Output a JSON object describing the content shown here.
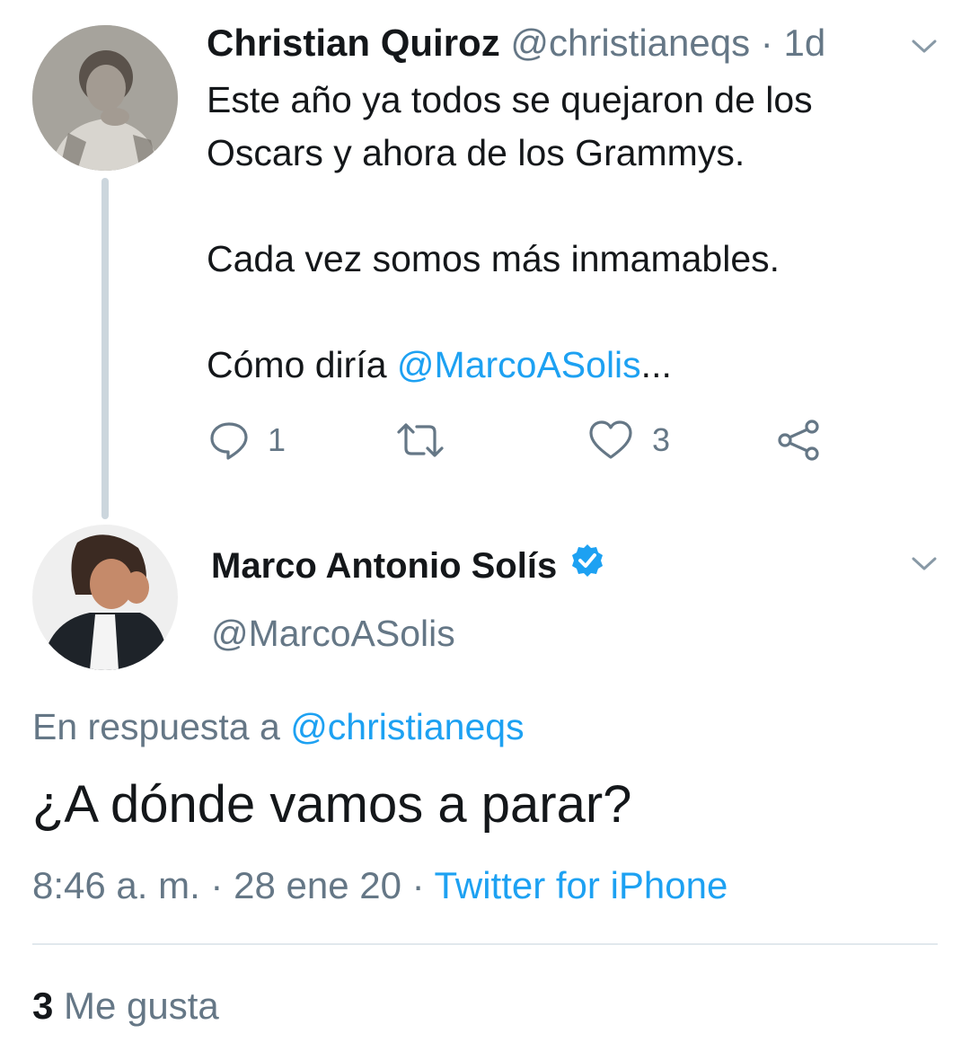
{
  "parent_tweet": {
    "author_name": "Christian Quiroz",
    "handle": "@christianeqs",
    "separator": "·",
    "time": "1d",
    "text_line_1": "Este año ya todos se quejaron de los Oscars y ahora de los Grammys.",
    "text_line_2": "Cada vez somos más inmamables.",
    "text_line_3_prefix": "Cómo diría ",
    "text_line_3_mention": "@MarcoASolis",
    "text_line_3_suffix": "...",
    "actions": {
      "reply_count": "1",
      "retweet_count": "",
      "like_count": "3"
    },
    "icons": [
      "chevron-down-icon",
      "reply-icon",
      "retweet-icon",
      "heart-icon",
      "share-icon"
    ]
  },
  "reply_tweet": {
    "author_name": "Marco Antonio Solís",
    "verified": true,
    "handle": "@MarcoASolis",
    "reply_to_prefix": "En respuesta a ",
    "reply_to_handle": "@christianeqs",
    "text": "¿A dónde vamos a parar?",
    "time": "8:46 a. m.",
    "date": "28 ene 20",
    "separator": " · ",
    "source": "Twitter for iPhone",
    "likes_count": "3",
    "likes_label": "Me gusta"
  },
  "colors": {
    "text": "#14171a",
    "secondary": "#657786",
    "link": "#1da1f2",
    "thread_line": "#ccd6dd",
    "divider": "#e1e8ed",
    "verified": "#1da1f2"
  }
}
